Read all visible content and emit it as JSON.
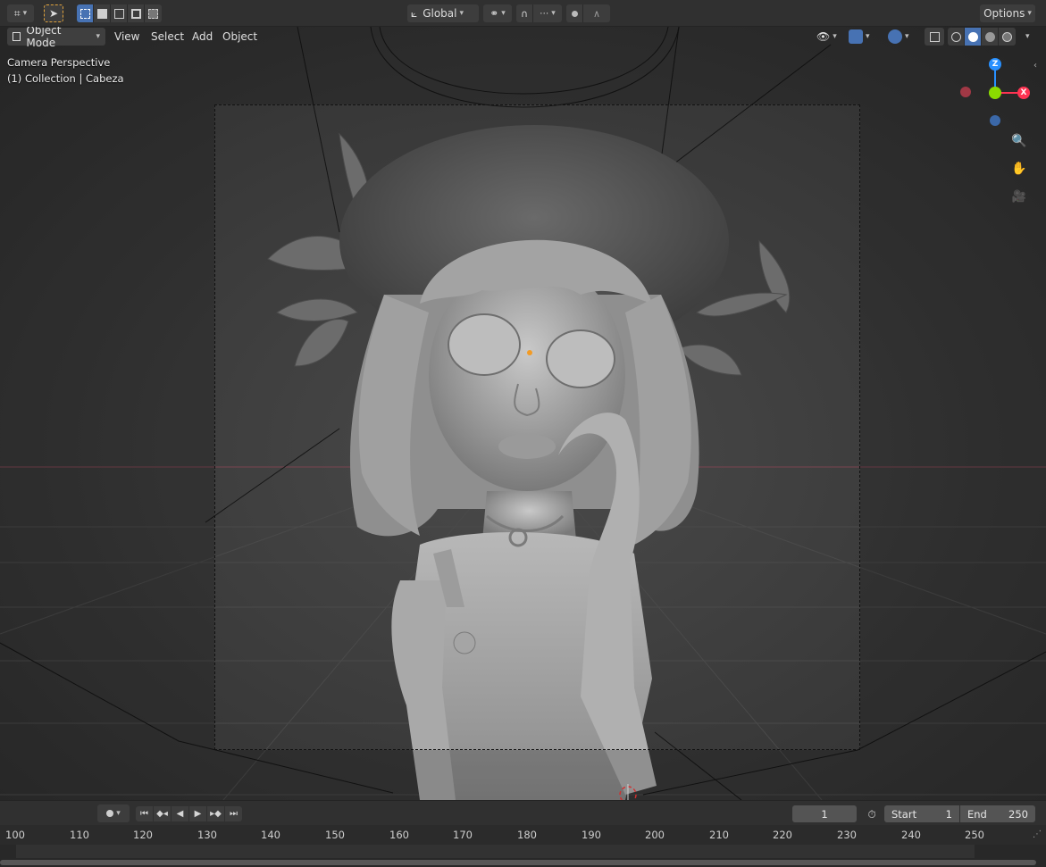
{
  "tool_header": {
    "transform_orientation": "Global",
    "options_label": "Options"
  },
  "viewport_header": {
    "mode": "Object Mode",
    "menus": [
      "View",
      "Select",
      "Add",
      "Object"
    ]
  },
  "viewport": {
    "view_name": "Camera Perspective",
    "collection_info": "(1) Collection | Cabeza"
  },
  "gizmo": {
    "z_label": "Z",
    "y_label": "",
    "x_label": "X",
    "colors": {
      "x": "#ff3352",
      "y": "#8bdc00",
      "z": "#2890ff",
      "neg_x": "#a13845",
      "neg_z": "#3b68a8"
    }
  },
  "timeline": {
    "current_frame": "1",
    "start_label": "Start",
    "start_value": "1",
    "end_label": "End",
    "end_value": "250",
    "ruler_ticks": [
      "100",
      "110",
      "120",
      "130",
      "140",
      "150",
      "160",
      "170",
      "180",
      "190",
      "200",
      "210",
      "220",
      "230",
      "240",
      "250"
    ]
  }
}
